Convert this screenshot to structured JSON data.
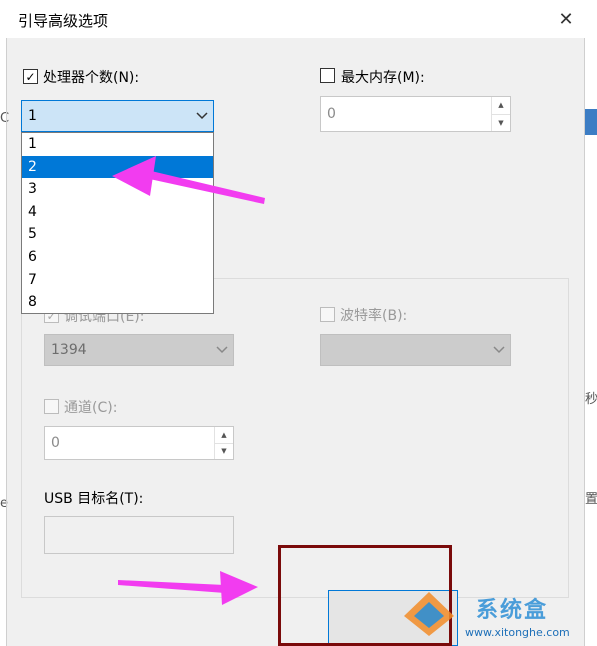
{
  "dialog": {
    "title": "引导高级选项",
    "close_glyph": "✕"
  },
  "processors": {
    "checkbox_checked": true,
    "label": "处理器个数(N):",
    "selected_value": "1",
    "options": [
      "1",
      "2",
      "3",
      "4",
      "5",
      "6",
      "7",
      "8"
    ],
    "highlighted_option": "2"
  },
  "max_memory": {
    "checkbox_checked": false,
    "label": "最大内存(M):",
    "value": "0"
  },
  "debug": {
    "debug_port_label": "调试端口(E):",
    "debug_port_value": "1394",
    "baud_rate_label": "波特率(B):",
    "baud_rate_value": "",
    "channel_label": "通道(C):",
    "channel_value": "0",
    "usb_target_label": "USB 目标名(T):",
    "usb_target_value": ""
  },
  "background_fragments": [
    "C",
    "秒",
    "置",
    "e"
  ],
  "watermark": {
    "text": "系统盒",
    "url": "www.xitonghe.com"
  },
  "colors": {
    "accent": "#0078d7",
    "annotation_arrow": "#f23cf0",
    "annotation_box": "#7a0a0a"
  }
}
